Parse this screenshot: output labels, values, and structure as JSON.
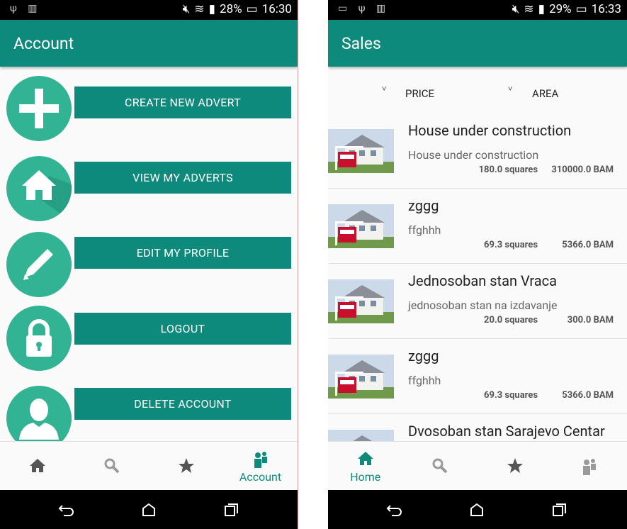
{
  "left": {
    "status": {
      "battery": "28%",
      "time": "16:30"
    },
    "title": "Account",
    "actions": [
      {
        "label": "CREATE NEW ADVERT",
        "icon": "plus-icon"
      },
      {
        "label": "VIEW MY ADVERTS",
        "icon": "home-icon"
      },
      {
        "label": "EDIT MY PROFILE",
        "icon": "pencil-icon"
      },
      {
        "label": "LOGOUT",
        "icon": "lock-icon"
      },
      {
        "label": "DELETE ACCOUNT",
        "icon": "user-icon"
      }
    ],
    "nav": {
      "active_label": "Account"
    }
  },
  "right": {
    "status": {
      "battery": "29%",
      "time": "16:33"
    },
    "title": "Sales",
    "filters": {
      "price": "PRICE",
      "area": "AREA"
    },
    "listings": [
      {
        "title": "House under construction",
        "desc": "House under construction",
        "area": "180.0 squares",
        "price": "310000.0 BAM"
      },
      {
        "title": "zggg",
        "desc": "ffghhh",
        "area": "69.3 squares",
        "price": "5366.0 BAM"
      },
      {
        "title": "Jednosoban stan Vraca",
        "desc": "jednosoban stan na izdavanje",
        "area": "20.0 squares",
        "price": "300.0 BAM"
      },
      {
        "title": "zggg",
        "desc": "ffghhh",
        "area": "69.3 squares",
        "price": "5366.0 BAM"
      },
      {
        "title": "Dvosoban stan Sarajevo Centar",
        "desc": "",
        "area": "",
        "price": ""
      }
    ],
    "nav": {
      "active_label": "Home"
    }
  },
  "colors": {
    "primary": "#0e8a7c",
    "circle": "#31b394",
    "inactive_icon": "#555555"
  }
}
